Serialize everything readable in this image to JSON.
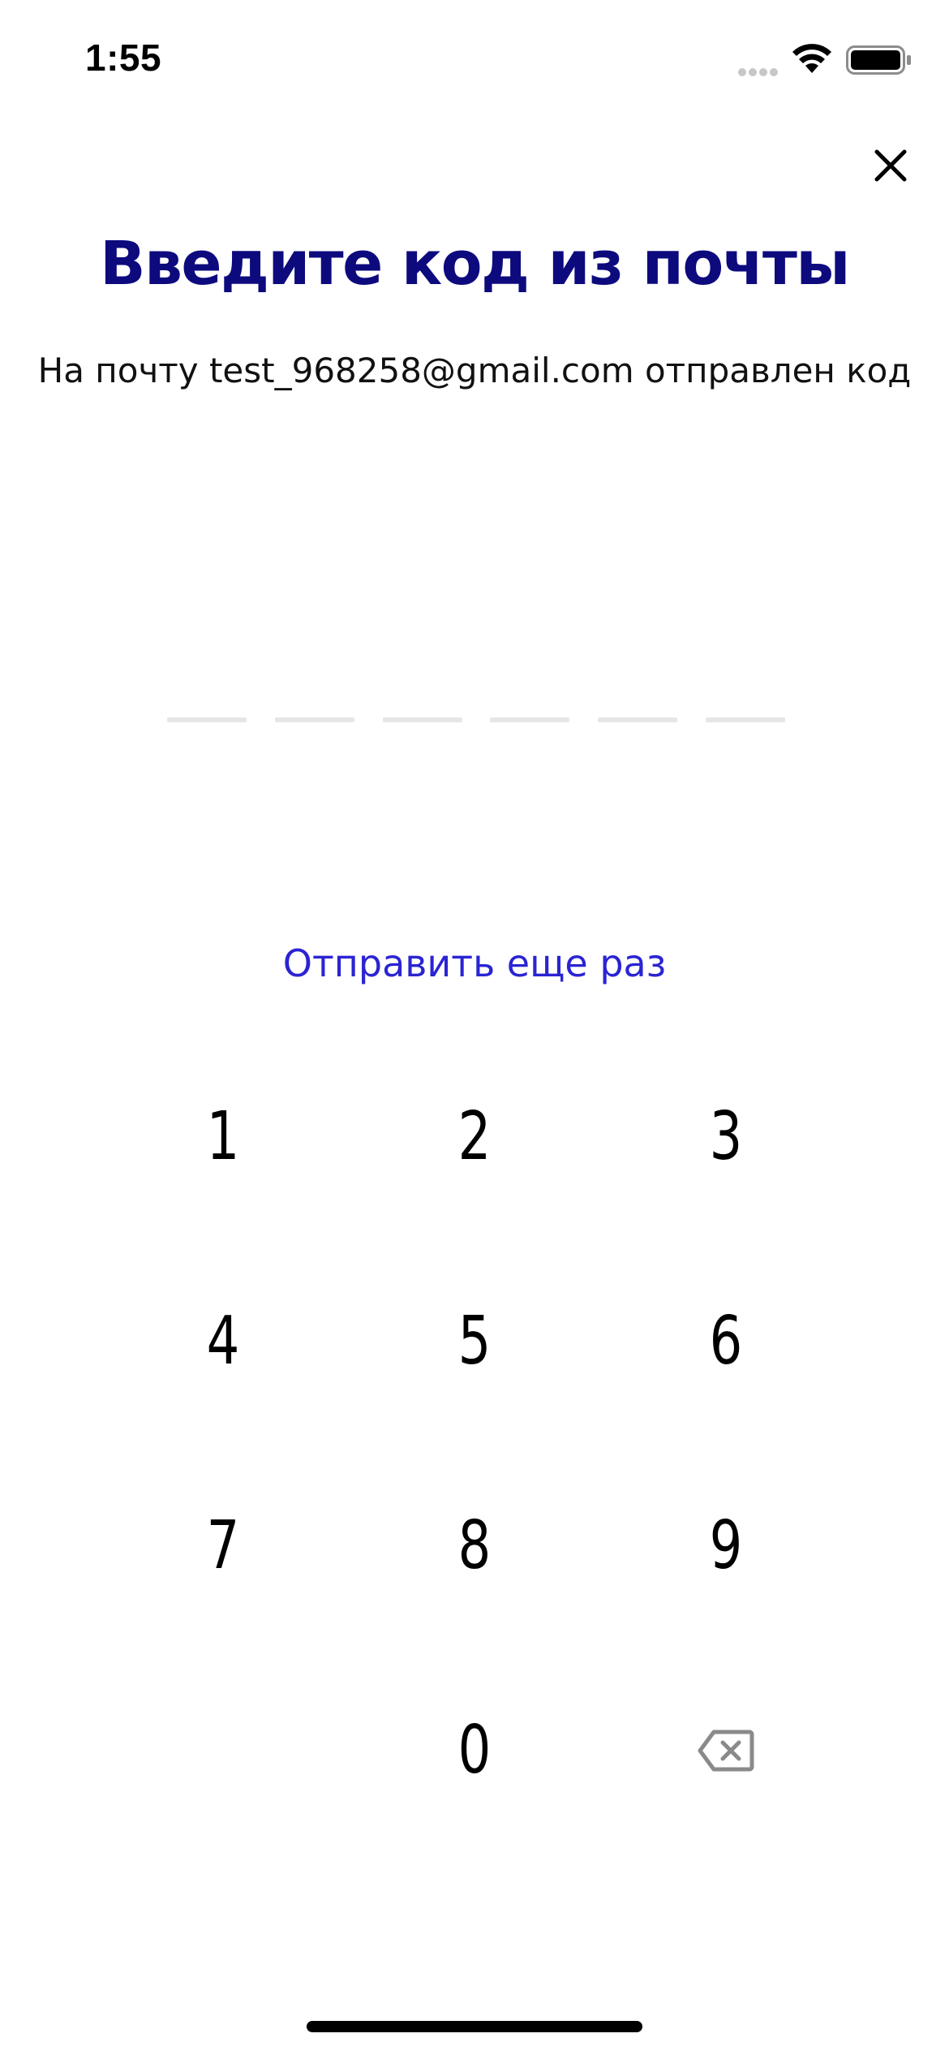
{
  "status_bar": {
    "time": "1:55",
    "signal_icon": "signal-dots-icon",
    "wifi_icon": "wifi-icon",
    "battery_icon": "battery-full-icon"
  },
  "header": {
    "close_icon": "close-icon"
  },
  "title": "Введите код из почты",
  "subtitle": "На почту test_968258@gmail.com отправлен код",
  "code": {
    "length": 6,
    "entered": ""
  },
  "resend_label": "Отправить еще раз",
  "keypad": {
    "keys": [
      "1",
      "2",
      "3",
      "4",
      "5",
      "6",
      "7",
      "8",
      "9",
      "0"
    ],
    "delete_icon": "backspace-icon"
  },
  "colors": {
    "title": "#0d0a7e",
    "link": "#2a24d2",
    "slot": "#e6e6e6"
  }
}
